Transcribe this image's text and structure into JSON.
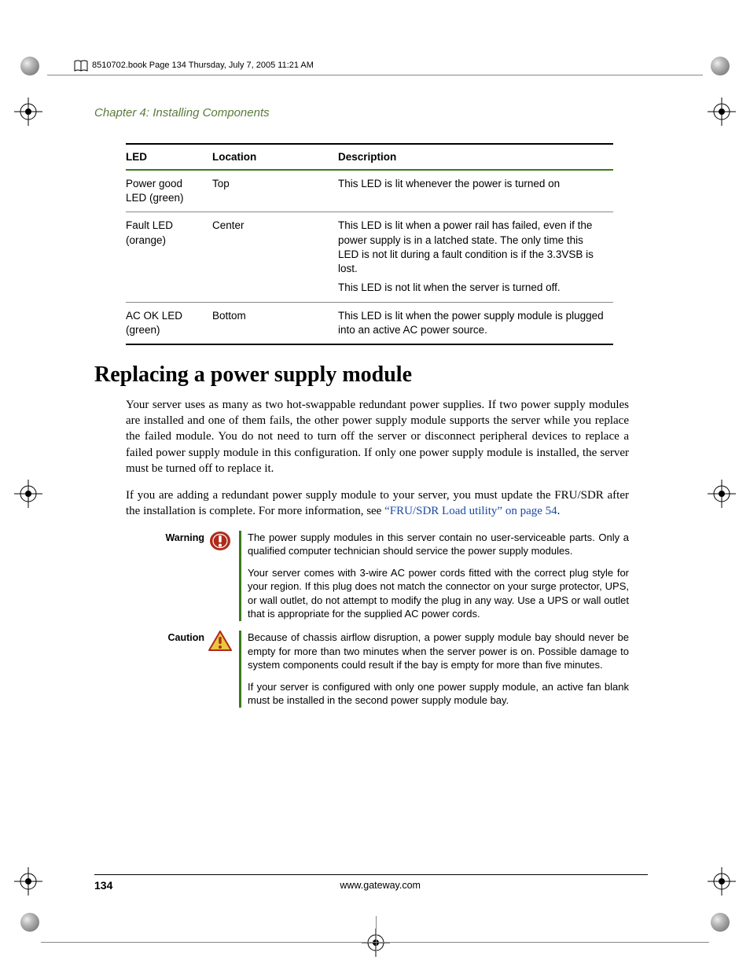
{
  "header": {
    "running_text": "8510702.book  Page 134  Thursday, July 7, 2005  11:21 AM"
  },
  "chapter": "Chapter 4: Installing Components",
  "table": {
    "headers": [
      "LED",
      "Location",
      "Description"
    ],
    "rows": [
      {
        "led": "Power good LED (green)",
        "location": "Top",
        "description": [
          "This LED is lit whenever the power is turned on"
        ]
      },
      {
        "led": "Fault LED (orange)",
        "location": "Center",
        "description": [
          "This LED is lit when a power rail has failed, even if the power supply is in a latched state. The only time this LED is not lit during a fault condition is if the 3.3VSB is lost.",
          "This LED is not lit when the server is turned off."
        ]
      },
      {
        "led": "AC OK LED (green)",
        "location": "Bottom",
        "description": [
          "This LED is lit when the power supply module is plugged into an active AC power source."
        ]
      }
    ]
  },
  "section_title": "Replacing a power supply module",
  "paragraphs": [
    "Your server uses as many as two hot-swappable redundant power supplies. If two power supply modules are installed and one of them fails, the other power supply module supports the server while you replace the failed module. You do not need to turn off the server or disconnect peripheral devices to replace a failed power supply module in this configuration. If only one power supply module is installed, the server must be turned off to replace it."
  ],
  "paragraph2_pre": "If you are adding a redundant power supply module to your server, you must update the FRU/SDR after the installation is complete. For more information, see ",
  "paragraph2_link": "“FRU/SDR Load utility” on page 54",
  "paragraph2_post": ".",
  "warning": {
    "label": "Warning",
    "paras": [
      "The power supply modules in this server contain no user-serviceable parts. Only a qualified computer technician should service the power supply modules.",
      "Your server comes with 3-wire AC power cords fitted with the correct plug style for your region. If this plug does not match the connector on your surge protector, UPS, or wall outlet, do not attempt to modify the plug in any way. Use a UPS or wall outlet that is appropriate for the supplied AC power cords."
    ]
  },
  "caution": {
    "label": "Caution",
    "paras": [
      "Because of chassis airflow disruption, a power supply module bay should never be empty for more than two minutes when the server power is on. Possible damage to system components could result if the bay is empty for more than five minutes.",
      "If your server is configured with only one power supply module, an active fan blank must be installed in the second power supply module bay."
    ]
  },
  "footer": {
    "page": "134",
    "url": "www.gateway.com"
  }
}
